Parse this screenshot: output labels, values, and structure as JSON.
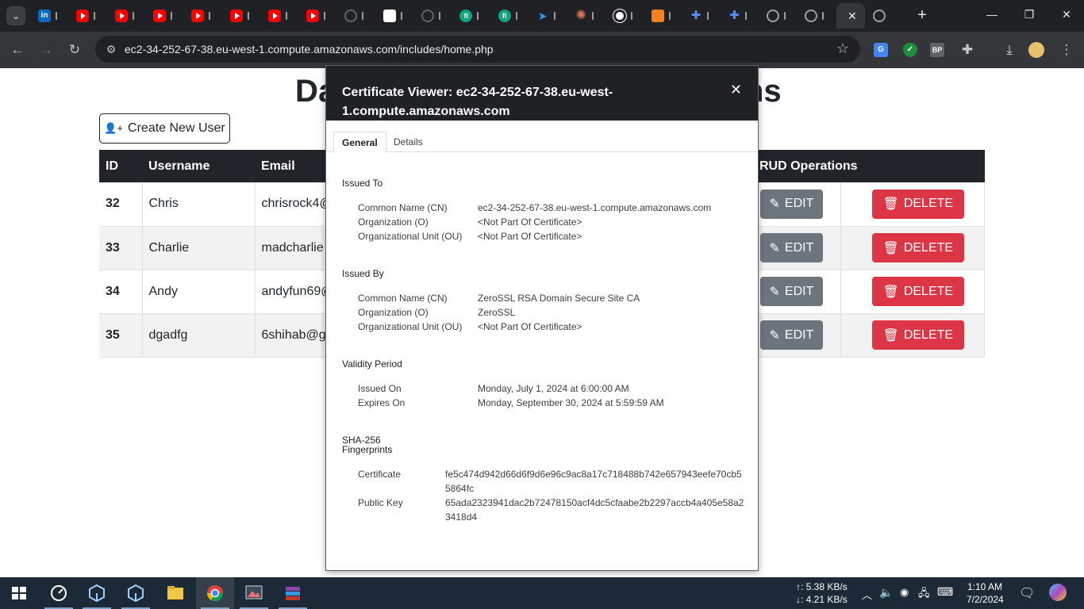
{
  "browser": {
    "tabs": [
      {
        "icon": "linkedin-icon",
        "glyph": "in",
        "cls": "li"
      },
      {
        "icon": "youtube-icon",
        "glyph": "",
        "cls": "yt"
      },
      {
        "icon": "youtube-icon",
        "glyph": "",
        "cls": "yt"
      },
      {
        "icon": "youtube-icon",
        "glyph": "",
        "cls": "yt"
      },
      {
        "icon": "youtube-icon",
        "glyph": "",
        "cls": "yt"
      },
      {
        "icon": "youtube-icon",
        "glyph": "",
        "cls": "yt"
      },
      {
        "icon": "youtube-icon",
        "glyph": "",
        "cls": "yt"
      },
      {
        "icon": "youtube-icon",
        "glyph": "",
        "cls": "yt"
      },
      {
        "icon": "github-icon",
        "glyph": "",
        "cls": "gh"
      },
      {
        "icon": "web-icon",
        "glyph": "",
        "cls": "wh"
      },
      {
        "icon": "github-icon",
        "glyph": "",
        "cls": "gh"
      },
      {
        "icon": "fi-icon",
        "glyph": "fi",
        "cls": "fi"
      },
      {
        "icon": "fi-icon",
        "glyph": "fi",
        "cls": "fi"
      },
      {
        "icon": "paper-plane-icon",
        "glyph": "➤",
        "cls": "tp"
      },
      {
        "icon": "claude-icon",
        "glyph": "✺",
        "cls": "cl"
      },
      {
        "icon": "chatgpt-icon",
        "glyph": "",
        "cls": "gpt"
      },
      {
        "icon": "orange-app-icon",
        "glyph": "",
        "cls": "or"
      },
      {
        "icon": "puzzle-icon",
        "glyph": "✚",
        "cls": "pz"
      },
      {
        "icon": "puzzle-icon",
        "glyph": "✚",
        "cls": "pz"
      },
      {
        "icon": "globe-icon",
        "glyph": "",
        "cls": "gl"
      },
      {
        "icon": "globe-icon",
        "glyph": "",
        "cls": "gl"
      }
    ],
    "active_tab_close": "✕",
    "after_tab_icon": "globe-icon",
    "new_tab": "+",
    "window": {
      "minimize": "—",
      "restore": "❐",
      "close": "✕"
    },
    "url": "ec2-34-252-67-38.eu-west-1.compute.amazonaws.com/includes/home.php",
    "nav": {
      "back": "←",
      "forward": "→",
      "reload": "↻"
    },
    "bookmark": "☆",
    "extensions": [
      {
        "name": "translate-extension-icon",
        "text": "G",
        "color": "#4285f4"
      },
      {
        "name": "shield-extension-icon",
        "text": "✓",
        "color": "#1e8e3e"
      },
      {
        "name": "bp-extension-icon",
        "text": "BP",
        "color": "#5f6368"
      }
    ]
  },
  "page": {
    "title_head": "Da",
    "title_tail": "ns",
    "create_button": "Create New User",
    "create_icon": "👤+",
    "columns": [
      "ID",
      "Username",
      "Email",
      "",
      "RUD Operations"
    ],
    "rows": [
      {
        "id": "32",
        "username": "Chris",
        "email": "chrisrock4@"
      },
      {
        "id": "33",
        "username": "Charlie",
        "email": "madcharlie"
      },
      {
        "id": "34",
        "username": "Andy",
        "email": "andyfun69@"
      },
      {
        "id": "35",
        "username": "dgadfg",
        "email": "6shihab@g"
      }
    ],
    "edit_label": "EDIT",
    "delete_label": "DELETE"
  },
  "certificate": {
    "title": "Certificate Viewer: ec2-34-252-67-38.eu-west-1.compute.amazonaws.com",
    "close": "✕",
    "tabs": [
      "General",
      "Details"
    ],
    "issued_to": {
      "heading": "Issued To",
      "cn_label": "Common Name (CN)",
      "cn": "ec2-34-252-67-38.eu-west-1.compute.amazonaws.com",
      "o_label": "Organization (O)",
      "o": "<Not Part Of Certificate>",
      "ou_label": "Organizational Unit (OU)",
      "ou": "<Not Part Of Certificate>"
    },
    "issued_by": {
      "heading": "Issued By",
      "cn_label": "Common Name (CN)",
      "cn": "ZeroSSL RSA Domain Secure Site CA",
      "o_label": "Organization (O)",
      "o": "ZeroSSL",
      "ou_label": "Organizational Unit (OU)",
      "ou": "<Not Part Of Certificate>"
    },
    "validity": {
      "heading": "Validity Period",
      "issued_label": "Issued On",
      "issued": "Monday, July 1, 2024 at 6:00:00 AM",
      "expires_label": "Expires On",
      "expires": "Monday, September 30, 2024 at 5:59:59 AM"
    },
    "fingerprints": {
      "heading_line1": "SHA-256",
      "heading_line2": "Fingerprints",
      "cert_label": "Certificate",
      "cert": "fe5c474d942d66d6f9d6e96c9ac8a17c718488b742e657943eefe70cb55864fc",
      "key_label": "Public Key",
      "key": "65ada2323941dac2b72478150acf4dc5cfaabe2b2297accb4a405e58a23418d4"
    }
  },
  "taskbar": {
    "upload_speed": "↑: 5.38 KB/s",
    "download_speed": "↓: 4.21 KB/s",
    "time": "1:10 AM",
    "date": "7/2/2024"
  }
}
